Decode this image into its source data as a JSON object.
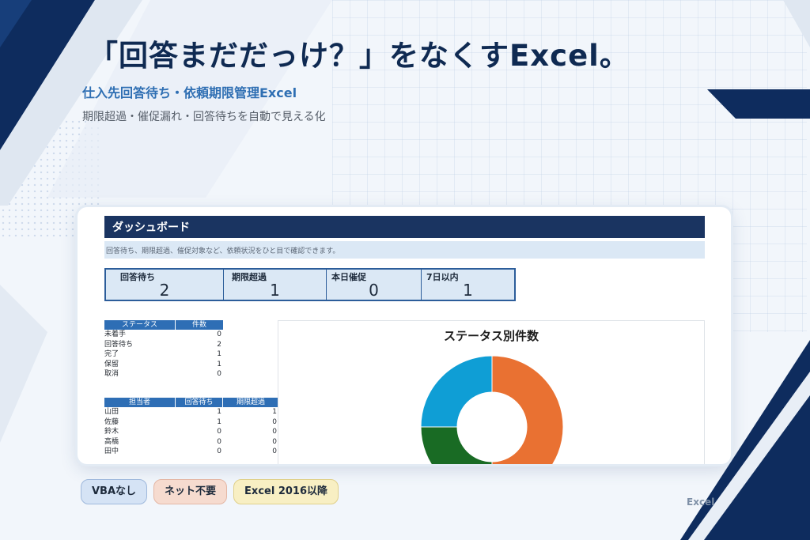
{
  "hero": {
    "title": "「回答まだだっけ？」をなくすExcel。",
    "subtitle": "仕入先回答待ち・依頼期限管理Excel",
    "description": "期限超過・催促漏れ・回答待ちを自動で見える化"
  },
  "dashboard": {
    "header": "ダッシュボード",
    "note": "回答待ち、期限超過、催促対象など、依頼状況をひと目で確認できます。",
    "kpis": [
      {
        "label": "回答待ち",
        "value": "2"
      },
      {
        "label": "期限超過",
        "value": "1"
      },
      {
        "label": "本日催促",
        "value": "0"
      },
      {
        "label": "7日以内",
        "value": "1"
      }
    ],
    "status_table": {
      "headers": [
        "ステータス",
        "件数"
      ],
      "rows": [
        {
          "name": "未着手",
          "count": "0"
        },
        {
          "name": "回答待ち",
          "count": "2"
        },
        {
          "name": "完了",
          "count": "1"
        },
        {
          "name": "保留",
          "count": "1"
        },
        {
          "name": "取消",
          "count": "0"
        }
      ]
    },
    "owner_table": {
      "headers": [
        "担当者",
        "回答待ち",
        "期限超過"
      ],
      "rows": [
        {
          "name": "山田",
          "waiting": "1",
          "overdue": "1"
        },
        {
          "name": "佐藤",
          "waiting": "1",
          "overdue": "0"
        },
        {
          "name": "鈴木",
          "waiting": "0",
          "overdue": "0"
        },
        {
          "name": "高橋",
          "waiting": "0",
          "overdue": "0"
        },
        {
          "name": "田中",
          "waiting": "0",
          "overdue": "0"
        }
      ]
    }
  },
  "chart_data": {
    "type": "pie",
    "title": "ステータス別件数",
    "donut": true,
    "categories": [
      "回答待ち",
      "完了",
      "保留"
    ],
    "values": [
      2,
      1,
      1
    ],
    "colors": [
      "#e97132",
      "#196b24",
      "#0f9ed5"
    ],
    "legend": "none"
  },
  "badges": [
    "VBAなし",
    "ネット不要",
    "Excel 2016以降"
  ],
  "watermark": "Excel",
  "colors": {
    "navy": "#1a3461",
    "accent_blue": "#2f6fb3",
    "table_header": "#2e6eb5",
    "kpi_bg": "#dbe8f5"
  }
}
